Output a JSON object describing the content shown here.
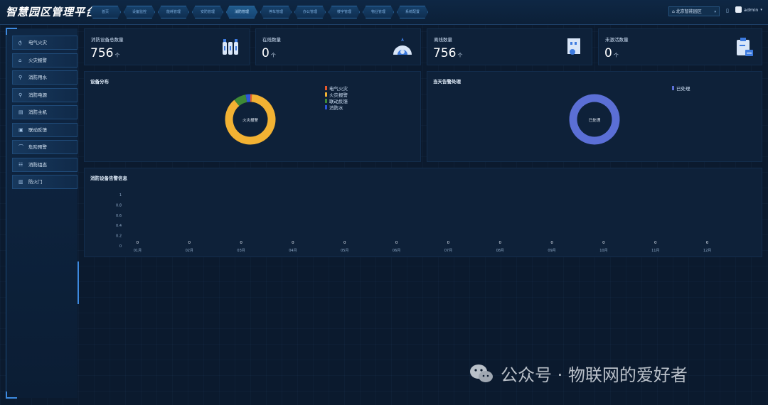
{
  "header": {
    "title": "智慧园区管理平台",
    "nav": [
      "首页",
      "设备监控",
      "能耗管理",
      "安防管理",
      "消防管理",
      "停车管理",
      "办公管理",
      "楼宇管理",
      "物业管理",
      "系统配置"
    ],
    "park_select": "北京智能园区",
    "user": "admin"
  },
  "sidebar": {
    "items": [
      {
        "label": "电气火灾",
        "icon": "fire-icon"
      },
      {
        "label": "火灾报警",
        "icon": "alarm-icon"
      },
      {
        "label": "消防用水",
        "icon": "water-icon"
      },
      {
        "label": "消防电源",
        "icon": "power-icon"
      },
      {
        "label": "消防主机",
        "icon": "host-icon"
      },
      {
        "label": "联动反馈",
        "icon": "feedback-icon"
      },
      {
        "label": "危险预警",
        "icon": "warning-icon"
      },
      {
        "label": "消防组态",
        "icon": "config-icon"
      },
      {
        "label": "防火门",
        "icon": "door-icon"
      }
    ]
  },
  "stats": [
    {
      "title": "消防设备总数量",
      "value": "756",
      "unit": "个"
    },
    {
      "title": "在线数量",
      "value": "0",
      "unit": "个"
    },
    {
      "title": "离线数量",
      "value": "756",
      "unit": "个"
    },
    {
      "title": "未激活数量",
      "value": "0",
      "unit": "个"
    }
  ],
  "device_distribution": {
    "title": "设备分布",
    "center_label": "火灾报警",
    "legend": [
      {
        "name": "电气火灾",
        "color": "#e8582c"
      },
      {
        "name": "火灾报警",
        "color": "#f2b233"
      },
      {
        "name": "联动反馈",
        "color": "#3e8a36"
      },
      {
        "name": "消防水",
        "color": "#2d56d8"
      }
    ]
  },
  "alarm_today": {
    "title": "当天告警处理",
    "center_label": "已处理",
    "legend": [
      {
        "name": "已处理",
        "color": "#5b6fd6"
      }
    ]
  },
  "alarm_info": {
    "title": "消防设备告警信息"
  },
  "chart_data": [
    {
      "type": "pie",
      "title": "设备分布",
      "categories": [
        "电气火灾",
        "火灾报警",
        "联动反馈",
        "消防水"
      ],
      "values": [
        1,
        88,
        8,
        3
      ],
      "colors": [
        "#e8582c",
        "#f2b233",
        "#3e8a36",
        "#2d56d8"
      ]
    },
    {
      "type": "pie",
      "title": "当天告警处理",
      "categories": [
        "已处理"
      ],
      "values": [
        100
      ],
      "colors": [
        "#5b6fd6"
      ]
    },
    {
      "type": "bar",
      "title": "消防设备告警信息",
      "categories": [
        "01月",
        "02月",
        "03月",
        "04月",
        "05月",
        "06月",
        "07月",
        "08月",
        "09月",
        "10月",
        "11月",
        "12月"
      ],
      "values": [
        0,
        0,
        0,
        0,
        0,
        0,
        0,
        0,
        0,
        0,
        0,
        0
      ],
      "ylim": [
        0,
        1
      ],
      "yticks": [
        "1",
        "0.8",
        "0.6",
        "0.4",
        "0.2",
        "0"
      ]
    }
  ],
  "watermark": {
    "text": "公众号 · 物联网的爱好者"
  }
}
